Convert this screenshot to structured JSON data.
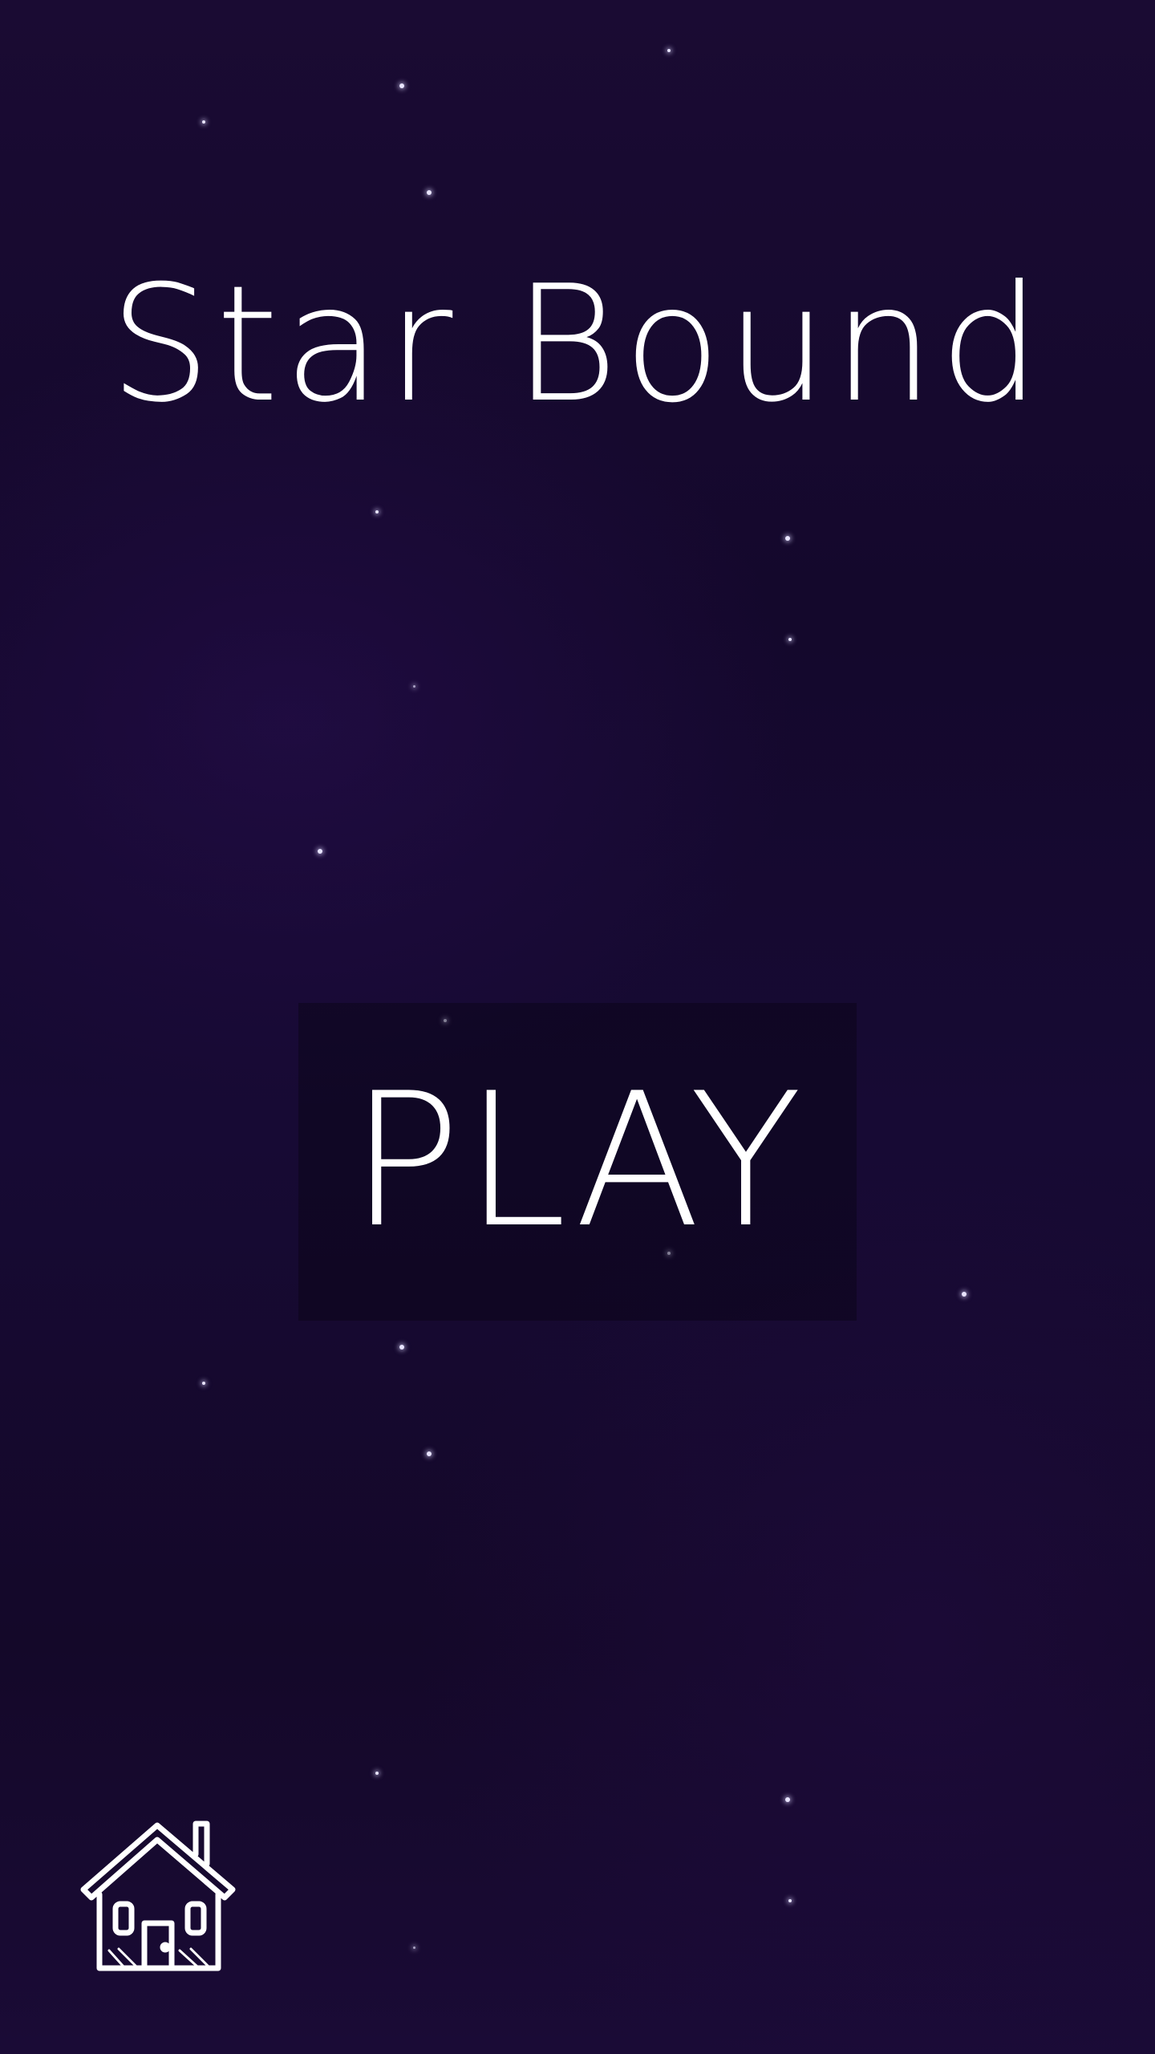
{
  "game": {
    "title": "Star Bound",
    "play_label": "PLAY"
  },
  "icons": {
    "home": "home-icon"
  },
  "colors": {
    "background": "#150930",
    "text": "#ffffff",
    "star": "#e8e4ff"
  }
}
